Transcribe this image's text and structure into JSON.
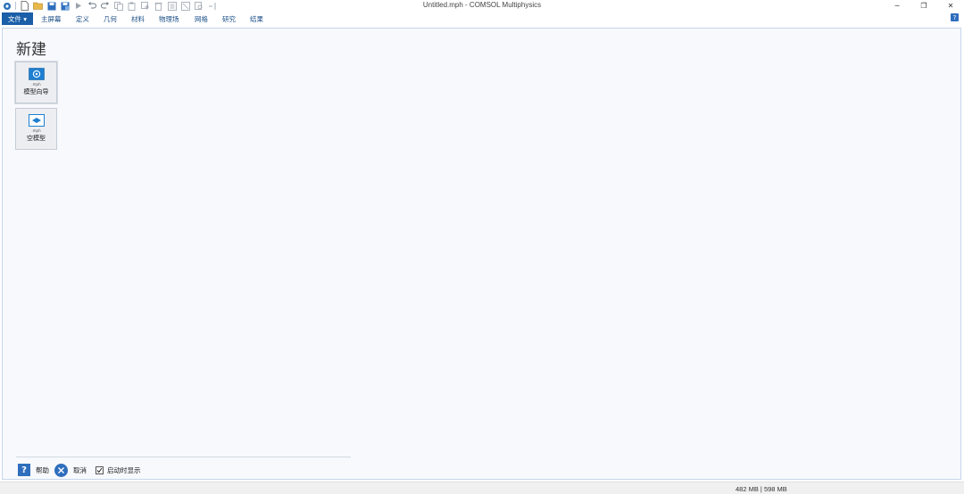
{
  "window": {
    "title": "Untitled.mph - COMSOL Multiphysics",
    "minimize_glyph": "─",
    "restore_glyph": "❐",
    "close_glyph": "✕"
  },
  "quick_access": {
    "icons": [
      "comsol-logo-icon",
      "new-file-icon",
      "open-folder-icon",
      "save-icon",
      "save-as-icon",
      "run-icon",
      "undo-icon",
      "redo-icon",
      "copy-icon",
      "paste-icon",
      "duplicate-icon",
      "delete-icon",
      "group-icon",
      "ungroup-icon",
      "find-icon",
      "more-icon"
    ]
  },
  "ribbon": {
    "file_label": "文件 ▾",
    "tabs": [
      "主屏幕",
      "定义",
      "几何",
      "材料",
      "物理场",
      "网格",
      "研究",
      "结果"
    ],
    "help_label": "?"
  },
  "new_page": {
    "title": "新建",
    "tiles": [
      {
        "ext": ".mph",
        "label": "模型向导"
      },
      {
        "ext": ".mph",
        "label": "空模型"
      }
    ]
  },
  "footer": {
    "help_label": "帮助",
    "cancel_label": "取消",
    "show_on_startup_label": "启动时显示",
    "show_on_startup_checked": true
  },
  "statusbar": {
    "memory": "482 MB | 598 MB"
  },
  "colors": {
    "accent": "#1b5fa8",
    "button_blue": "#2f6ebd",
    "content_bg": "#f7f9fd"
  }
}
